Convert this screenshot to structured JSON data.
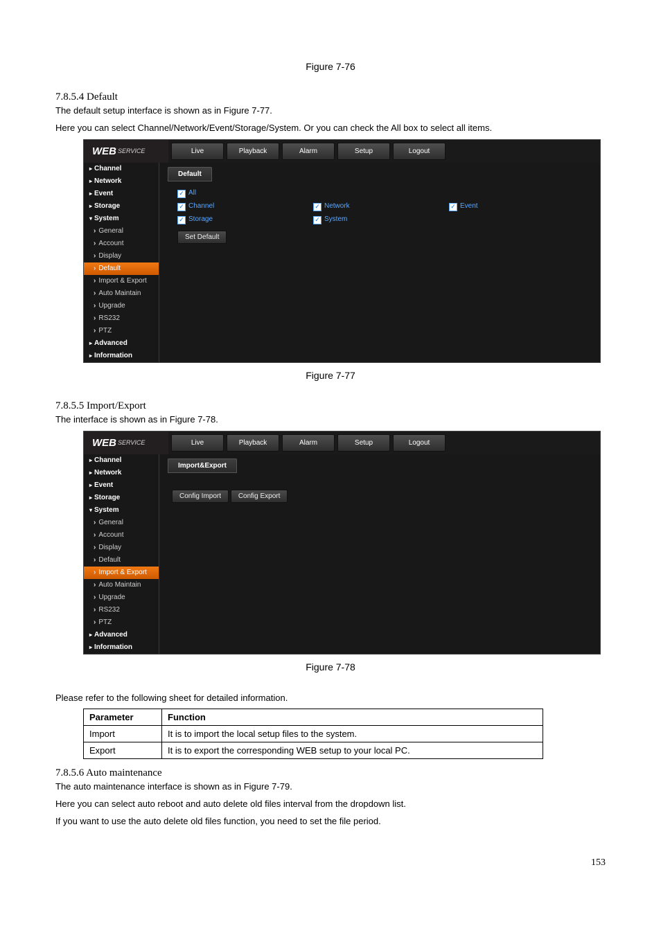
{
  "fig76": "Figure 7-76",
  "fig77": "Figure 7-77",
  "fig78": "Figure 7-78",
  "sec_default": {
    "heading": "7.8.5.4 Default",
    "p1": "The default setup interface is shown as in Figure 7-77.",
    "p2": "Here you can select Channel/Network/Event/Storage/System. Or you can check the All box to select all items."
  },
  "sec_ie": {
    "heading": "7.8.5.5 Import/Export",
    "p1": "The interface is shown as in Figure 7-78."
  },
  "table": {
    "intro": "Please refer to the following sheet for detailed information.",
    "h1": "Parameter",
    "h2": "Function",
    "r1c1": "Import",
    "r1c2": "It is to import the local setup files to the system.",
    "r2c1": "Export",
    "r2c2": "It is to export the corresponding WEB setup to your local PC."
  },
  "sec_auto": {
    "heading": "7.8.5.6 Auto maintenance",
    "p1": "The auto maintenance interface is shown as in Figure 7-79.",
    "p2": "Here you can select auto reboot and auto delete old files interval from the dropdown list.",
    "p3": "If you want to use the auto delete old files function, you need to set the file period."
  },
  "web": {
    "brand": "WEB",
    "brand2": "SERVICE",
    "tabs": [
      "Live",
      "Playback",
      "Alarm",
      "Setup",
      "Logout"
    ]
  },
  "ss1": {
    "content_tab": "Default",
    "chk_all": "All",
    "chk_channel": "Channel",
    "chk_network": "Network",
    "chk_event": "Event",
    "chk_storage": "Storage",
    "chk_system": "System",
    "btn": "Set Default",
    "side_cat": {
      "channel": "Channel",
      "network": "Network",
      "event": "Event",
      "storage": "Storage",
      "system": "System",
      "advanced": "Advanced",
      "information": "Information"
    },
    "side_sys": [
      "General",
      "Account",
      "Display",
      "Default",
      "Import & Export",
      "Auto Maintain",
      "Upgrade",
      "RS232",
      "PTZ"
    ]
  },
  "ss2": {
    "content_tab": "Import&Export",
    "btn_import": "Config Import",
    "btn_export": "Config Export",
    "side_cat": {
      "channel": "Channel",
      "network": "Network",
      "event": "Event",
      "storage": "Storage",
      "system": "System",
      "advanced": "Advanced",
      "information": "Information"
    },
    "side_sys": [
      "General",
      "Account",
      "Display",
      "Default",
      "Import & Export",
      "Auto Maintain",
      "Upgrade",
      "RS232",
      "PTZ"
    ]
  },
  "page_num": "153"
}
